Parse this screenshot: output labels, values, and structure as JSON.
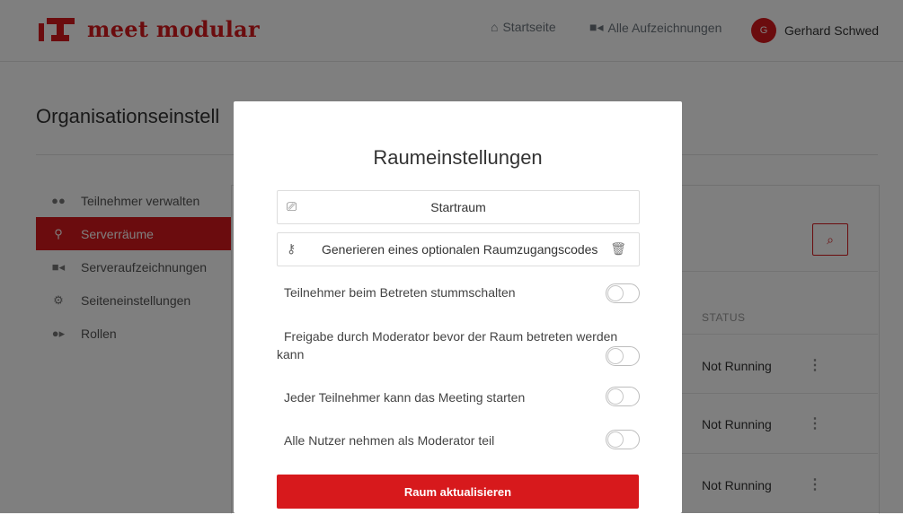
{
  "header": {
    "brand": "meet modular",
    "nav": [
      {
        "icon": "home-icon",
        "label": "Startseite"
      },
      {
        "icon": "video-camera-icon",
        "label": "Alle Aufzeichnungen"
      }
    ],
    "user": {
      "initial": "G",
      "name": "Gerhard Schwed"
    }
  },
  "page": {
    "title": "Organisationseinstell",
    "sidebar": [
      {
        "icon": "users-icon",
        "label": "Teilnehmer verwalten",
        "active": false
      },
      {
        "icon": "binoculars-icon",
        "label": "Serverräume",
        "active": true
      },
      {
        "icon": "video-camera-icon",
        "label": "Serveraufzeichnungen",
        "active": false
      },
      {
        "icon": "gears-icon",
        "label": "Seiteneinstellungen",
        "active": false
      },
      {
        "icon": "user-plus-icon",
        "label": "Rollen",
        "active": false
      }
    ],
    "table": {
      "status_header": "STATUS",
      "rows": [
        {
          "status": "Not Running"
        },
        {
          "status": "Not Running"
        },
        {
          "status": "Not Running"
        }
      ]
    }
  },
  "modal": {
    "title": "Raumeinstellungen",
    "room_name": "Startraum",
    "access_code_label": "Generieren eines optionalen Raumzugangscodes",
    "toggles": [
      {
        "label": "Teilnehmer beim Betreten stummschalten",
        "on": false
      },
      {
        "label": "Freigabe durch Moderator bevor der Raum betreten werden kann",
        "on": false
      },
      {
        "label": "Jeder Teilnehmer kann das Meeting starten",
        "on": false
      },
      {
        "label": "Alle Nutzer nehmen als Moderator teil",
        "on": false
      }
    ],
    "submit_label": "Raum aktualisieren"
  },
  "colors": {
    "brand": "#d7191c",
    "overlay": "rgba(0,0,0,0.5)"
  }
}
